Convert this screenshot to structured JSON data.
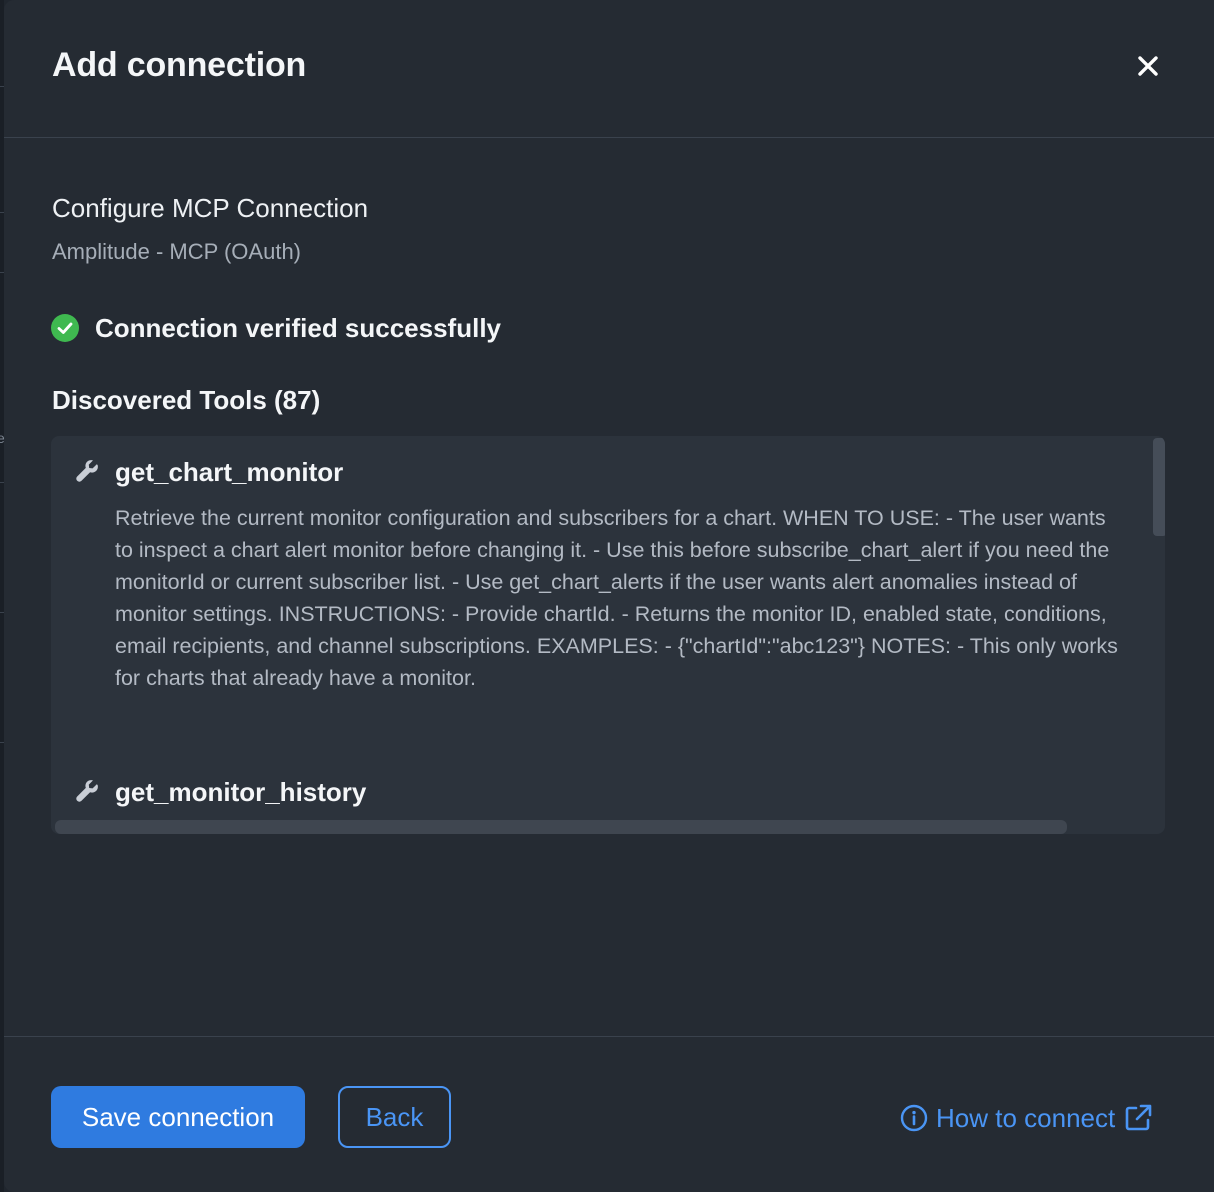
{
  "dialog": {
    "title": "Add connection"
  },
  "config": {
    "title": "Configure MCP Connection",
    "subtitle": "Amplitude - MCP (OAuth)"
  },
  "status": {
    "text": "Connection verified successfully",
    "color": "#3fb950"
  },
  "tools": {
    "heading": "Discovered Tools (87)",
    "items": [
      {
        "name": "get_chart_monitor",
        "icon": "wrench-icon",
        "description": "Retrieve the current monitor configuration and subscribers for a chart. WHEN TO USE: - The user wants to inspect a chart alert monitor before changing it. - Use this before subscribe_chart_alert if you need the monitorId or current subscriber list. - Use get_chart_alerts if the user wants alert anomalies instead of monitor settings. INSTRUCTIONS: - Provide chartId. - Returns the monitor ID, enabled state, conditions, email recipients, and channel subscriptions. EXAMPLES: - {\"chartId\":\"abc123\"} NOTES: - This only works for charts that already have a monitor."
      },
      {
        "name": "get_monitor_history",
        "icon": "wrench-icon",
        "description": ""
      }
    ]
  },
  "footer": {
    "save_label": "Save connection",
    "back_label": "Back",
    "help_label": "How to connect",
    "help_icon": "info-icon",
    "external_icon": "external-link-icon"
  },
  "colors": {
    "primary": "#2f7be0",
    "link": "#4a95f5",
    "background": "#252b33",
    "panel": "#2c333c"
  }
}
